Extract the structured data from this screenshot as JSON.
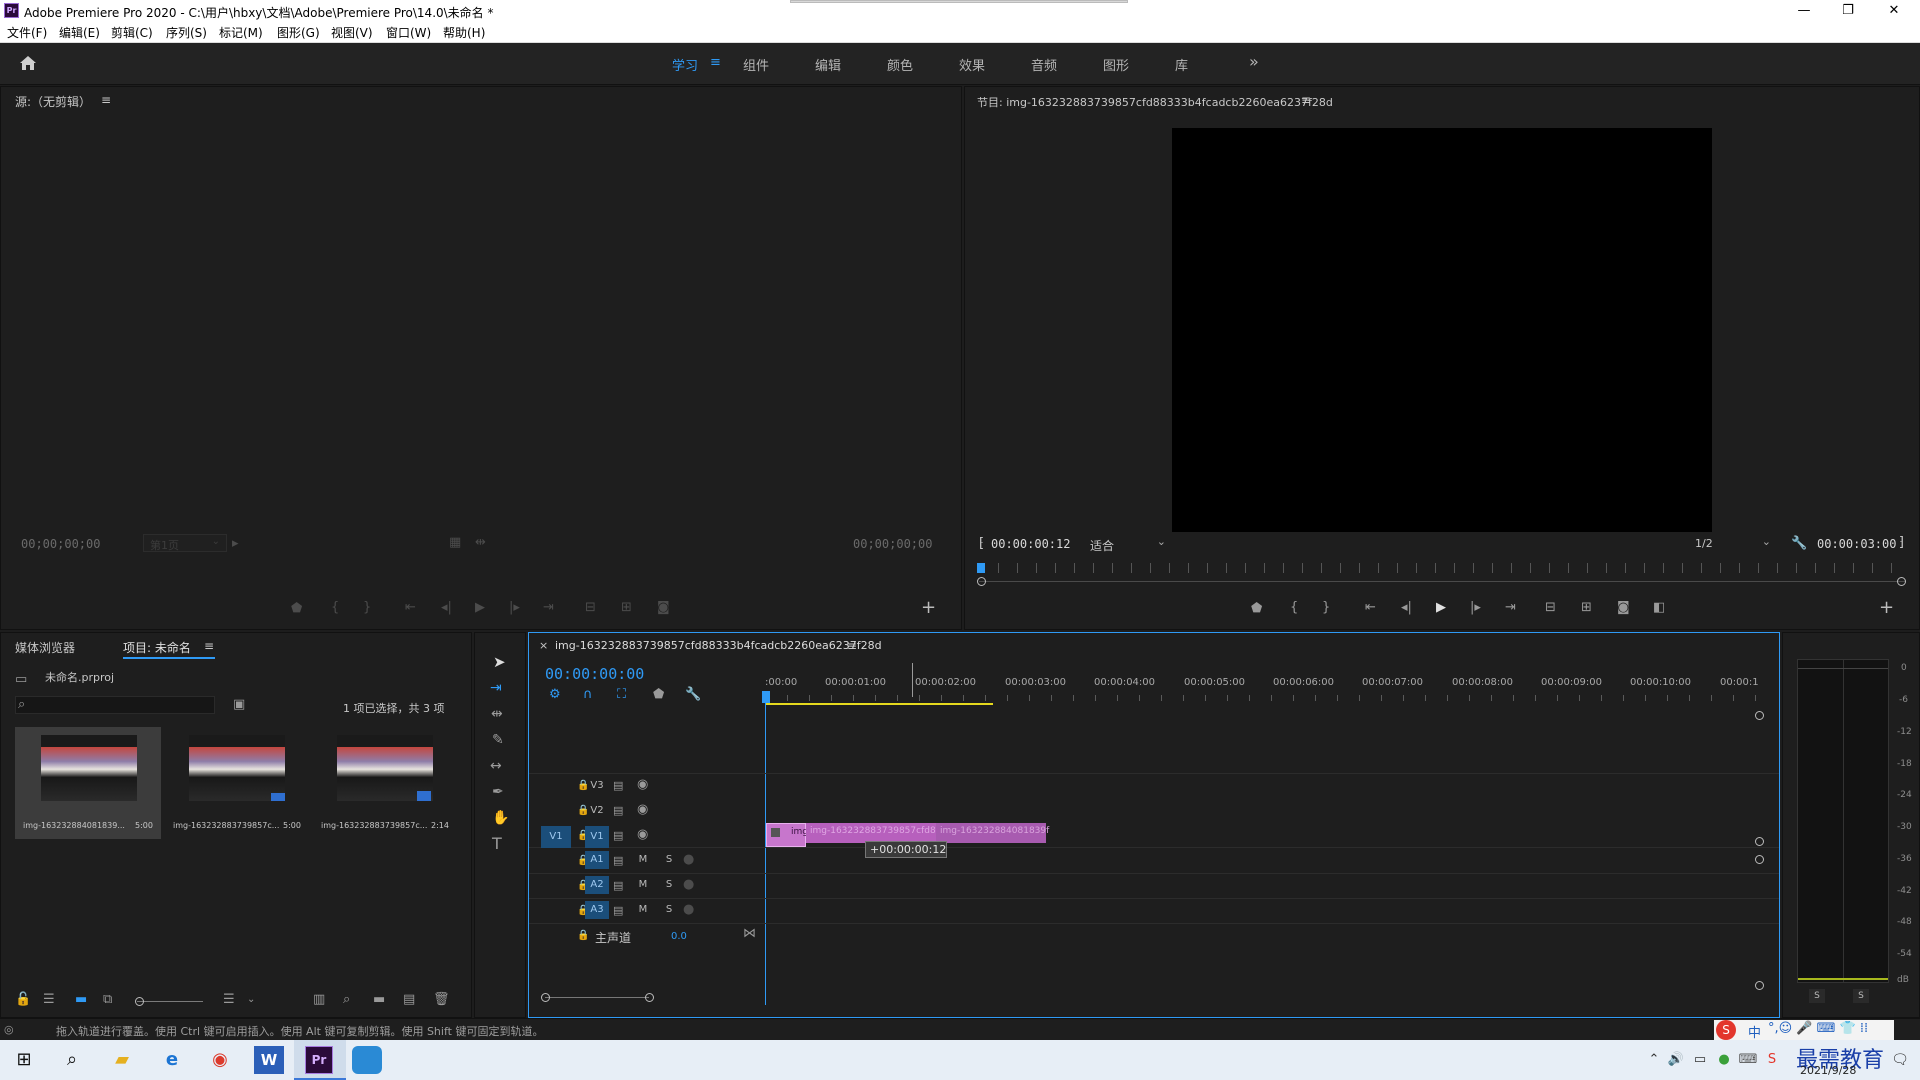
{
  "window": {
    "title": "Adobe Premiere Pro 2020 - C:\\用户\\hbxy\\文档\\Adobe\\Premiere Pro\\14.0\\未命名 *",
    "app_icon_label": "Pr",
    "minimize": "—",
    "restore": "❐",
    "close": "✕"
  },
  "menu": [
    "文件(F)",
    "编辑(E)",
    "剪辑(C)",
    "序列(S)",
    "标记(M)",
    "图形(G)",
    "视图(V)",
    "窗口(W)",
    "帮助(H)"
  ],
  "workspaces": [
    "学习",
    "组件",
    "编辑",
    "颜色",
    "效果",
    "音频",
    "图形",
    "库"
  ],
  "workspace_active": "学习",
  "workspace_menu": "≡",
  "workspace_more": "»",
  "source": {
    "title": "源:（无剪辑）",
    "menu": "≡",
    "tc_left": "00;00;00;00",
    "page_select": "第1页",
    "tc_right": "00;00;00;00",
    "add": "+"
  },
  "program": {
    "title": "节目: img-163232883739857cfd88333b4fcadcb2260ea6237f28d",
    "menu": "≡",
    "tc_current": "00:00:00:12",
    "fit": "适合",
    "resolution": "1/2",
    "tc_duration": "00:00:03:00",
    "add": "+"
  },
  "project": {
    "tab_media": "媒体浏览器",
    "tab_project": "项目: 未命名",
    "menu": "≡",
    "file": "未命名.prproj",
    "search_placeholder": "",
    "selection_count": "1 项已选择，共 3 项",
    "items": [
      {
        "name": "img-163232884081839...",
        "duration": "5:00"
      },
      {
        "name": "img-163232883739857c...",
        "duration": "5:00"
      },
      {
        "name": "img-163232883739857c...",
        "duration": "2:14"
      }
    ]
  },
  "timeline": {
    "tab_close": "×",
    "tab_title": "img-163232883739857cfd88333b4fcadcb2260ea6237f28d",
    "menu": "≡",
    "timecode": "00:00:00:00",
    "ruler": [
      ":00:00",
      "00:00:01:00",
      "00:00:02:00",
      "00:00:03:00",
      "00:00:04:00",
      "00:00:05:00",
      "00:00:06:00",
      "00:00:07:00",
      "00:00:08:00",
      "00:00:09:00",
      "00:00:10:00",
      "00:00:1"
    ],
    "tracks_video": [
      "V3",
      "V2",
      "V1"
    ],
    "tracks_audio": [
      "A1",
      "A2",
      "A3"
    ],
    "source_patch_v": "V1",
    "audio_m": "M",
    "audio_s": "S",
    "master_label": "主声道",
    "master_value": "0.0",
    "clip1_label": "img",
    "clip2_label": "img-163232883739857cfd8",
    "clip3_label": "img-163232884081839f",
    "drag_tooltip": "+00:00:00:12"
  },
  "meter": {
    "scale": [
      "0",
      "-6",
      "-12",
      "-18",
      "-24",
      "-30",
      "-36",
      "-42",
      "-48",
      "-54",
      "dB"
    ],
    "solo_left": "S",
    "solo_right": "S"
  },
  "status": {
    "text": "拖入轨道进行覆盖。使用 Ctrl 键可启用插入。使用 Alt 键可复制剪辑。使用 Shift 键可固定到轨道。"
  },
  "taskbar": {
    "date": "2021/9/28",
    "watermark": "最需教育",
    "ime": "中"
  },
  "colors": {
    "accent": "#2f9af5",
    "clip": "#c061c6",
    "workarea": "#e5d91e"
  }
}
